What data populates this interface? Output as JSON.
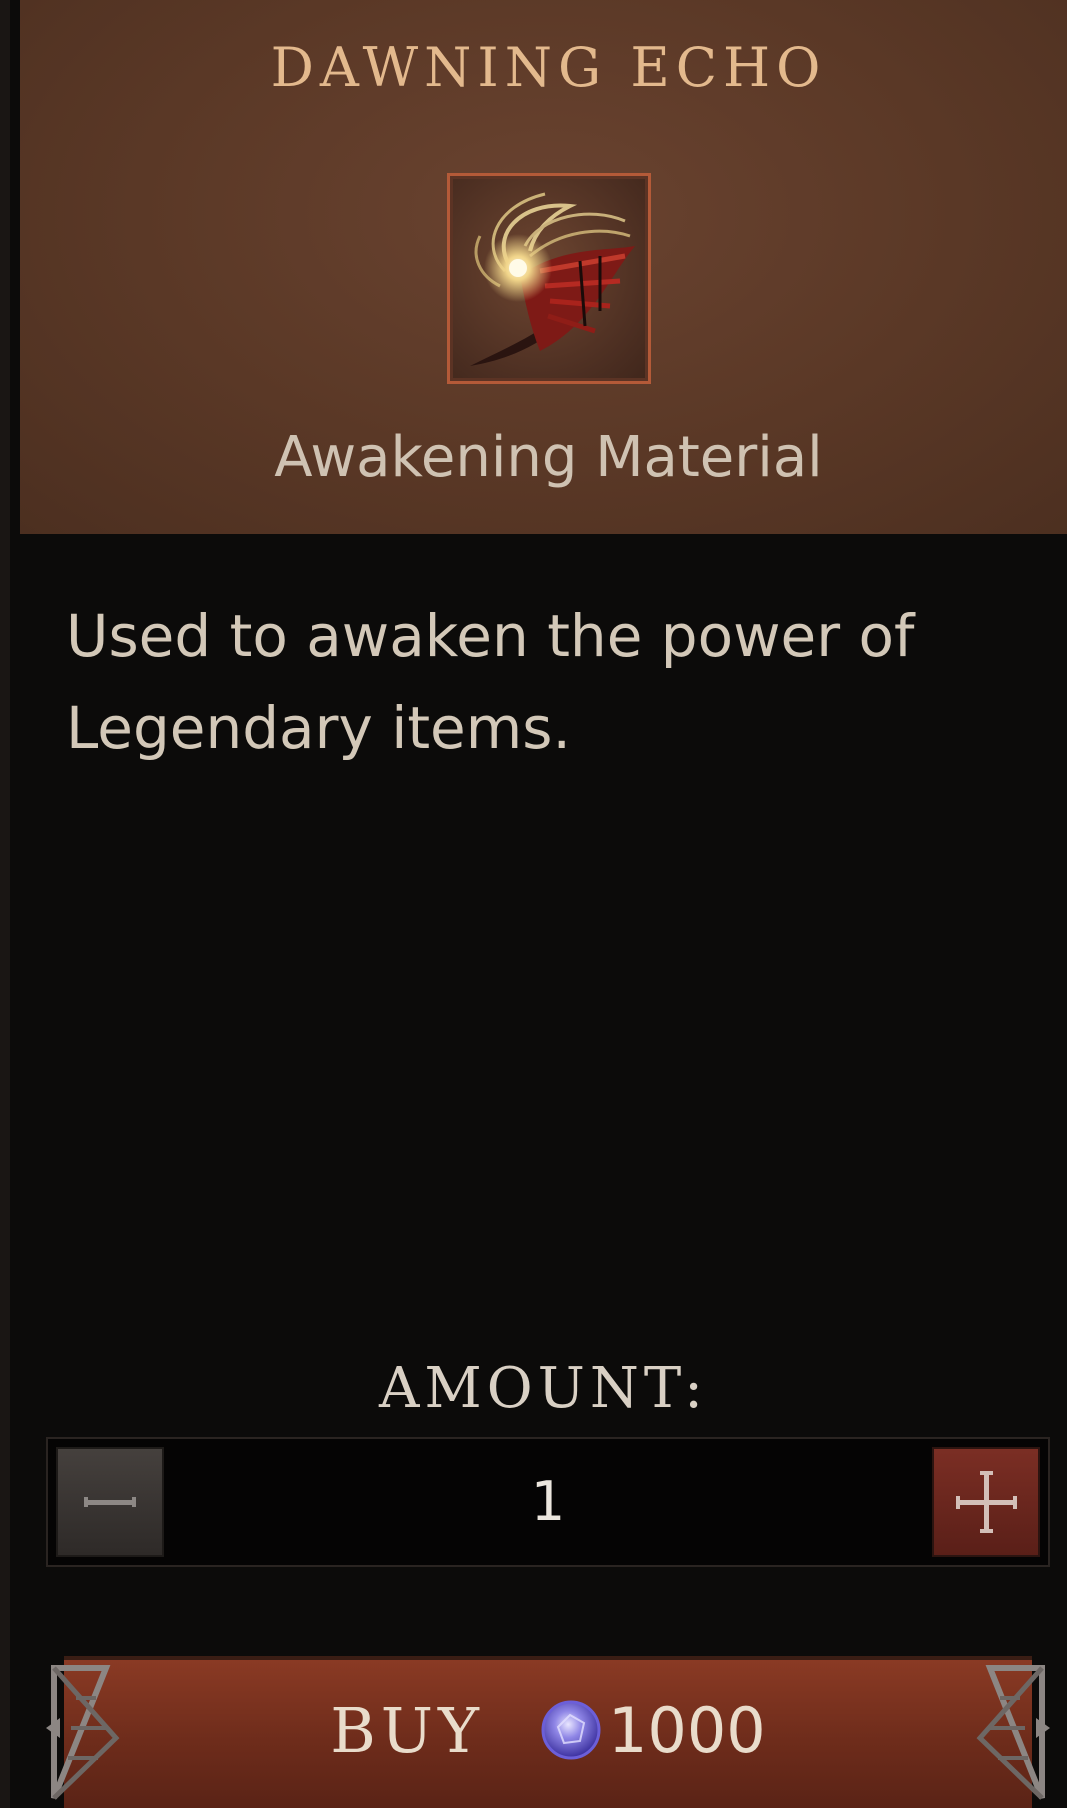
{
  "item": {
    "name": "DAWNING ECHO",
    "type": "Awakening Material",
    "icon": "dawning-echo-feather-icon",
    "description": "Used to awaken the power of Legendary items."
  },
  "amount": {
    "label": "AMOUNT:",
    "value": "1",
    "decrement_icon": "minus-icon",
    "increment_icon": "plus-icon"
  },
  "buy": {
    "label": "BUY",
    "currency_icon": "gem-orb-icon",
    "price": "1000"
  },
  "colors": {
    "header_bg": "#5a3826",
    "title": "#e3b98d",
    "text": "#d3c8b8",
    "buy_bg": "#7a3220",
    "plus_btn": "#6b261d",
    "minus_btn": "#3a3532"
  }
}
